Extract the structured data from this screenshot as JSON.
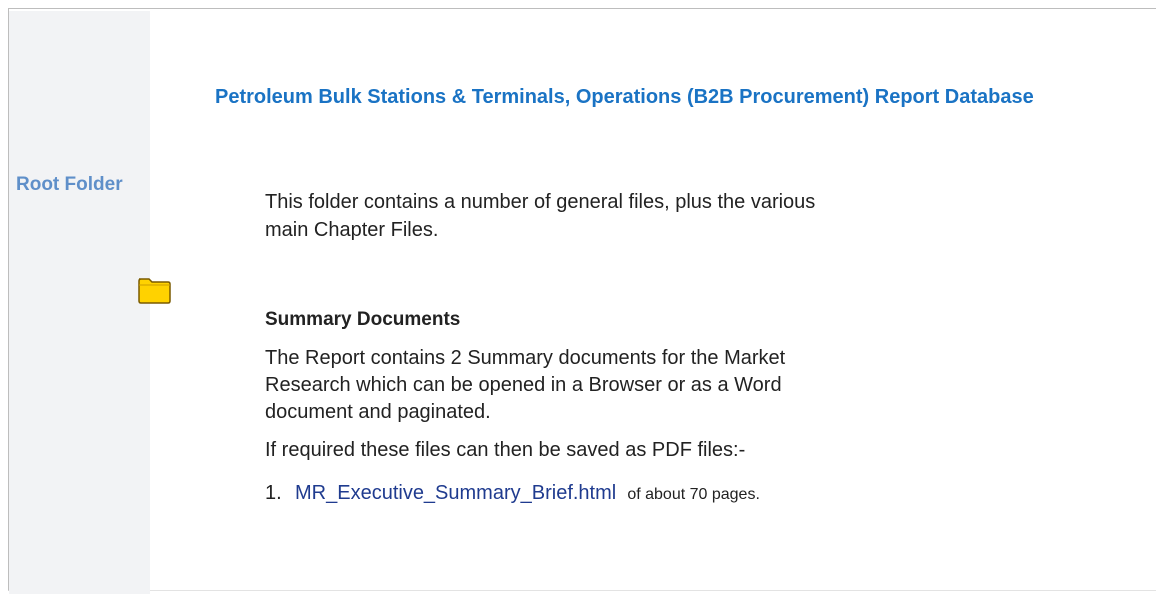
{
  "header": {
    "title": "Petroleum Bulk Stations & Terminals, Operations (B2B Procurement) Report Database"
  },
  "sidebar": {
    "root_label": "Root Folder",
    "folder_icon": "folder-icon",
    "folder_color": "#ffd200"
  },
  "content": {
    "intro": "This folder contains a number of general files, plus the various main Chapter Files.",
    "summary_heading": "Summary Documents",
    "summary_text": "The Report contains 2 Summary documents for the Market Research which can be opened in a Browser or as a Word document and paginated.",
    "required_text": "If required these files can then be saved as PDF files:-",
    "items": [
      {
        "number": "1.",
        "link_text": "MR_Executive_Summary_Brief.html",
        "suffix": "of about 70 pages."
      }
    ]
  },
  "colors": {
    "title": "#1a73c4",
    "root_label": "#5f8fc9",
    "sidebar_bg": "#f2f3f5",
    "link": "#1f3b8f"
  }
}
